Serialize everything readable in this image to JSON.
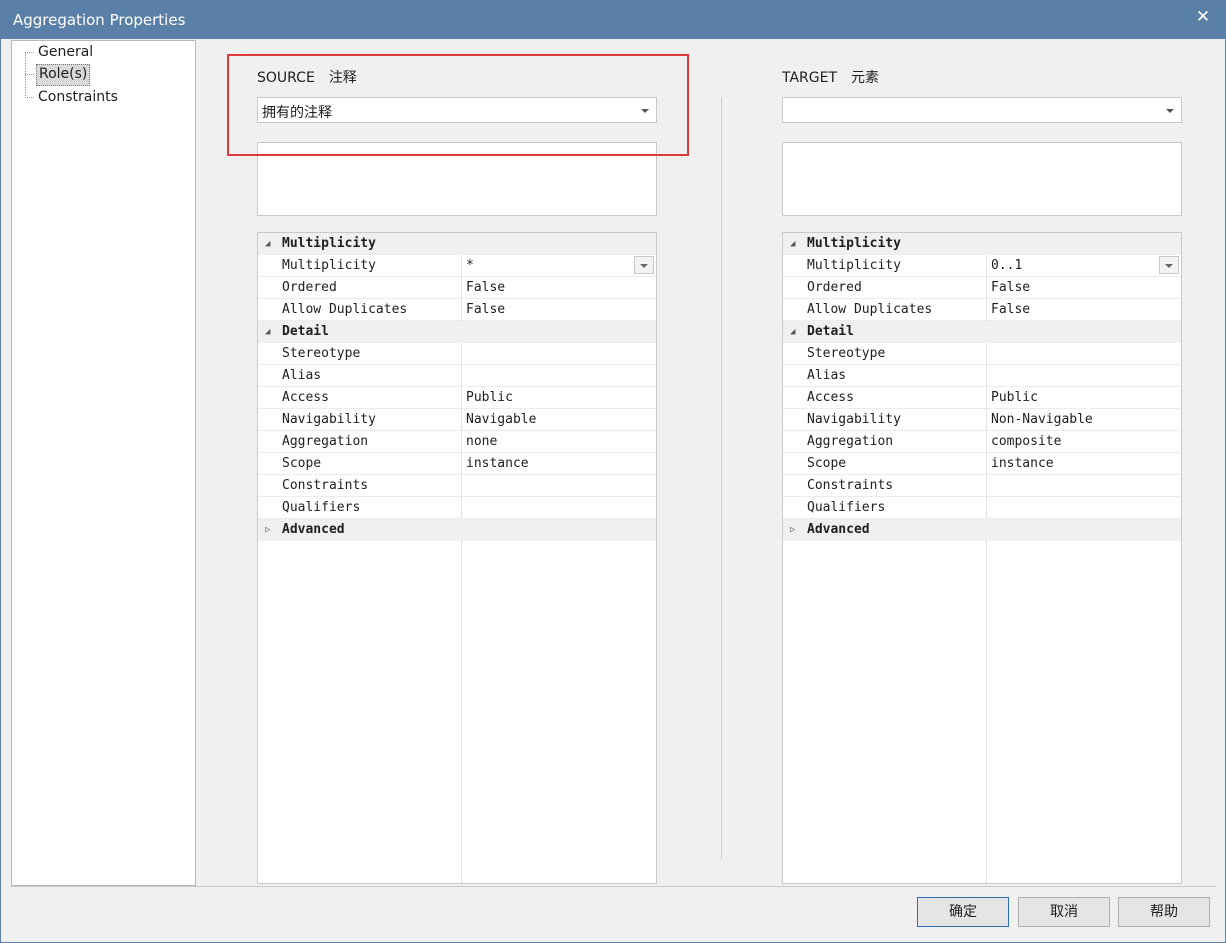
{
  "window": {
    "title": "Aggregation Properties",
    "close_glyph": "✕"
  },
  "nav": {
    "items": [
      {
        "label": "General",
        "selected": false
      },
      {
        "label": "Role(s)",
        "selected": true
      },
      {
        "label": "Constraints",
        "selected": false
      }
    ]
  },
  "source": {
    "label": "SOURCE",
    "type": "注释",
    "role_value": "拥有的注释",
    "groups": [
      {
        "name": "Multiplicity",
        "expanded": true,
        "props": [
          {
            "name": "Multiplicity",
            "value": "*"
          },
          {
            "name": "Ordered",
            "value": "False"
          },
          {
            "name": "Allow Duplicates",
            "value": "False"
          }
        ]
      },
      {
        "name": "Detail",
        "expanded": true,
        "props": [
          {
            "name": "Stereotype",
            "value": ""
          },
          {
            "name": "Alias",
            "value": ""
          },
          {
            "name": "Access",
            "value": "Public"
          },
          {
            "name": "Navigability",
            "value": "Navigable"
          },
          {
            "name": "Aggregation",
            "value": "none"
          },
          {
            "name": "Scope",
            "value": "instance"
          },
          {
            "name": "Constraints",
            "value": ""
          },
          {
            "name": "Qualifiers",
            "value": ""
          }
        ]
      },
      {
        "name": "Advanced",
        "expanded": false,
        "props": []
      }
    ]
  },
  "target": {
    "label": "TARGET",
    "type": "元素",
    "role_value": "",
    "groups": [
      {
        "name": "Multiplicity",
        "expanded": true,
        "props": [
          {
            "name": "Multiplicity",
            "value": "0..1"
          },
          {
            "name": "Ordered",
            "value": "False"
          },
          {
            "name": "Allow Duplicates",
            "value": "False"
          }
        ]
      },
      {
        "name": "Detail",
        "expanded": true,
        "props": [
          {
            "name": "Stereotype",
            "value": ""
          },
          {
            "name": "Alias",
            "value": ""
          },
          {
            "name": "Access",
            "value": "Public"
          },
          {
            "name": "Navigability",
            "value": "Non-Navigable"
          },
          {
            "name": "Aggregation",
            "value": "composite"
          },
          {
            "name": "Scope",
            "value": "instance"
          },
          {
            "name": "Constraints",
            "value": ""
          },
          {
            "name": "Qualifiers",
            "value": ""
          }
        ]
      },
      {
        "name": "Advanced",
        "expanded": false,
        "props": []
      }
    ]
  },
  "buttons": {
    "ok": "确定",
    "cancel": "取消",
    "help": "帮助"
  },
  "colors": {
    "titlebar": "#5b80a8",
    "highlight": "#e0393b"
  }
}
